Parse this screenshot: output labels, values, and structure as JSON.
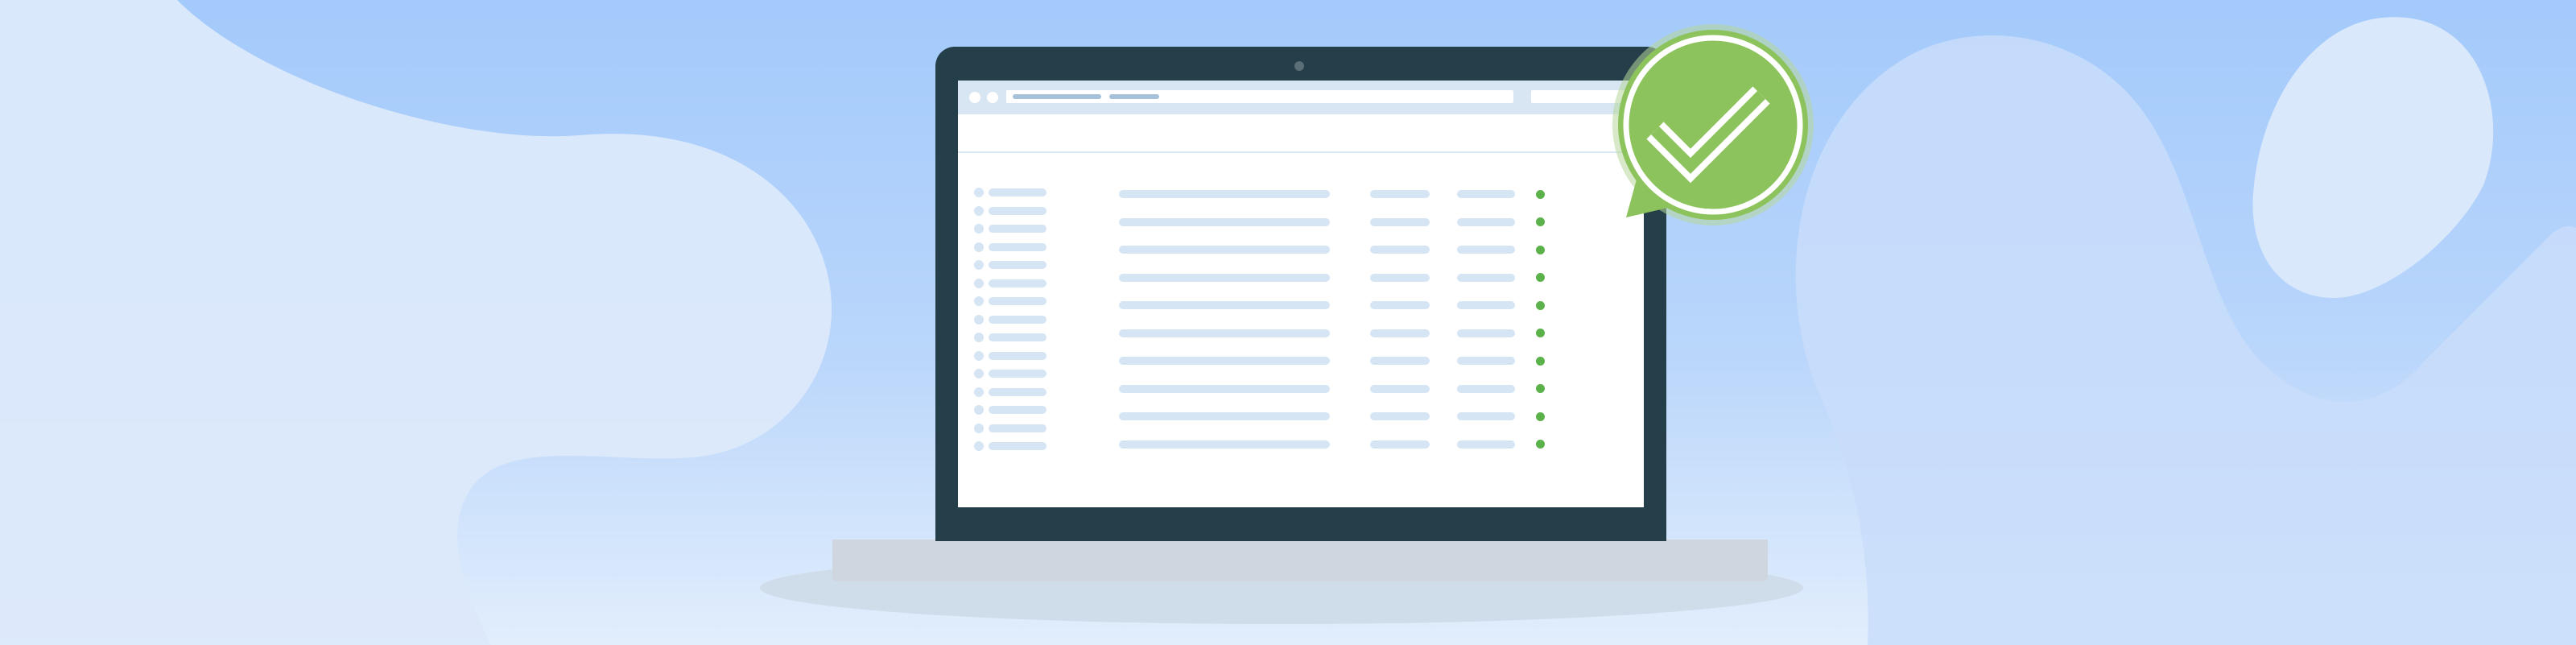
{
  "scene": {
    "description_free": true,
    "colors": {
      "sky": "#a3cafb",
      "blob": "#dce9fb",
      "laptop_frame": "#243e4a",
      "placeholder": "#d6e5f3",
      "status_ok": "#5bb24a",
      "badge_green": "#8dc35c"
    }
  },
  "icons": {
    "badge": "checkmark-badge-icon",
    "camera": "webcam-icon"
  },
  "screen": {
    "left_list_rows": 15,
    "table_rows": 10,
    "status_states": [
      "ok",
      "ok",
      "ok",
      "ok",
      "ok",
      "ok",
      "ok",
      "ok",
      "ok",
      "ok"
    ]
  }
}
